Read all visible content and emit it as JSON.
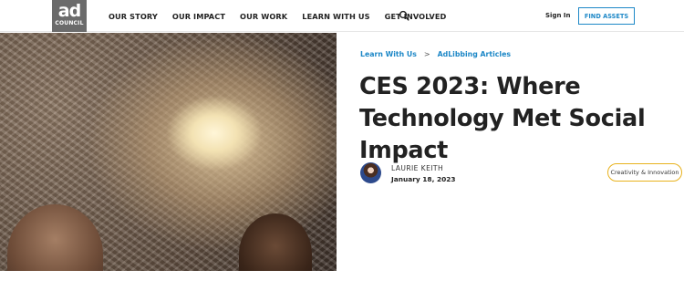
{
  "header": {
    "logo": {
      "line1": "ad",
      "line2": "COUNCIL"
    },
    "nav": [
      {
        "label": "OUR STORY"
      },
      {
        "label": "OUR IMPACT"
      },
      {
        "label": "OUR WORK"
      },
      {
        "label": "LEARN WITH US"
      },
      {
        "label": "GET INVOLVED"
      }
    ],
    "search_icon": "search-icon",
    "sign_in": "Sign In",
    "cta": "FIND ASSETS"
  },
  "breadcrumb": {
    "items": [
      "Learn With Us",
      "AdLibbing Articles"
    ],
    "separator": ">"
  },
  "article": {
    "title": "CES 2023: Where Technology Met Social Impact",
    "author": "LAURIE KEITH",
    "date": "January 18, 2023",
    "tag": "Creativity & Innovation"
  },
  "colors": {
    "accent": "#1e88c7",
    "tag_border": "#e8b21e",
    "logo_bg": "#6b6b6b"
  }
}
